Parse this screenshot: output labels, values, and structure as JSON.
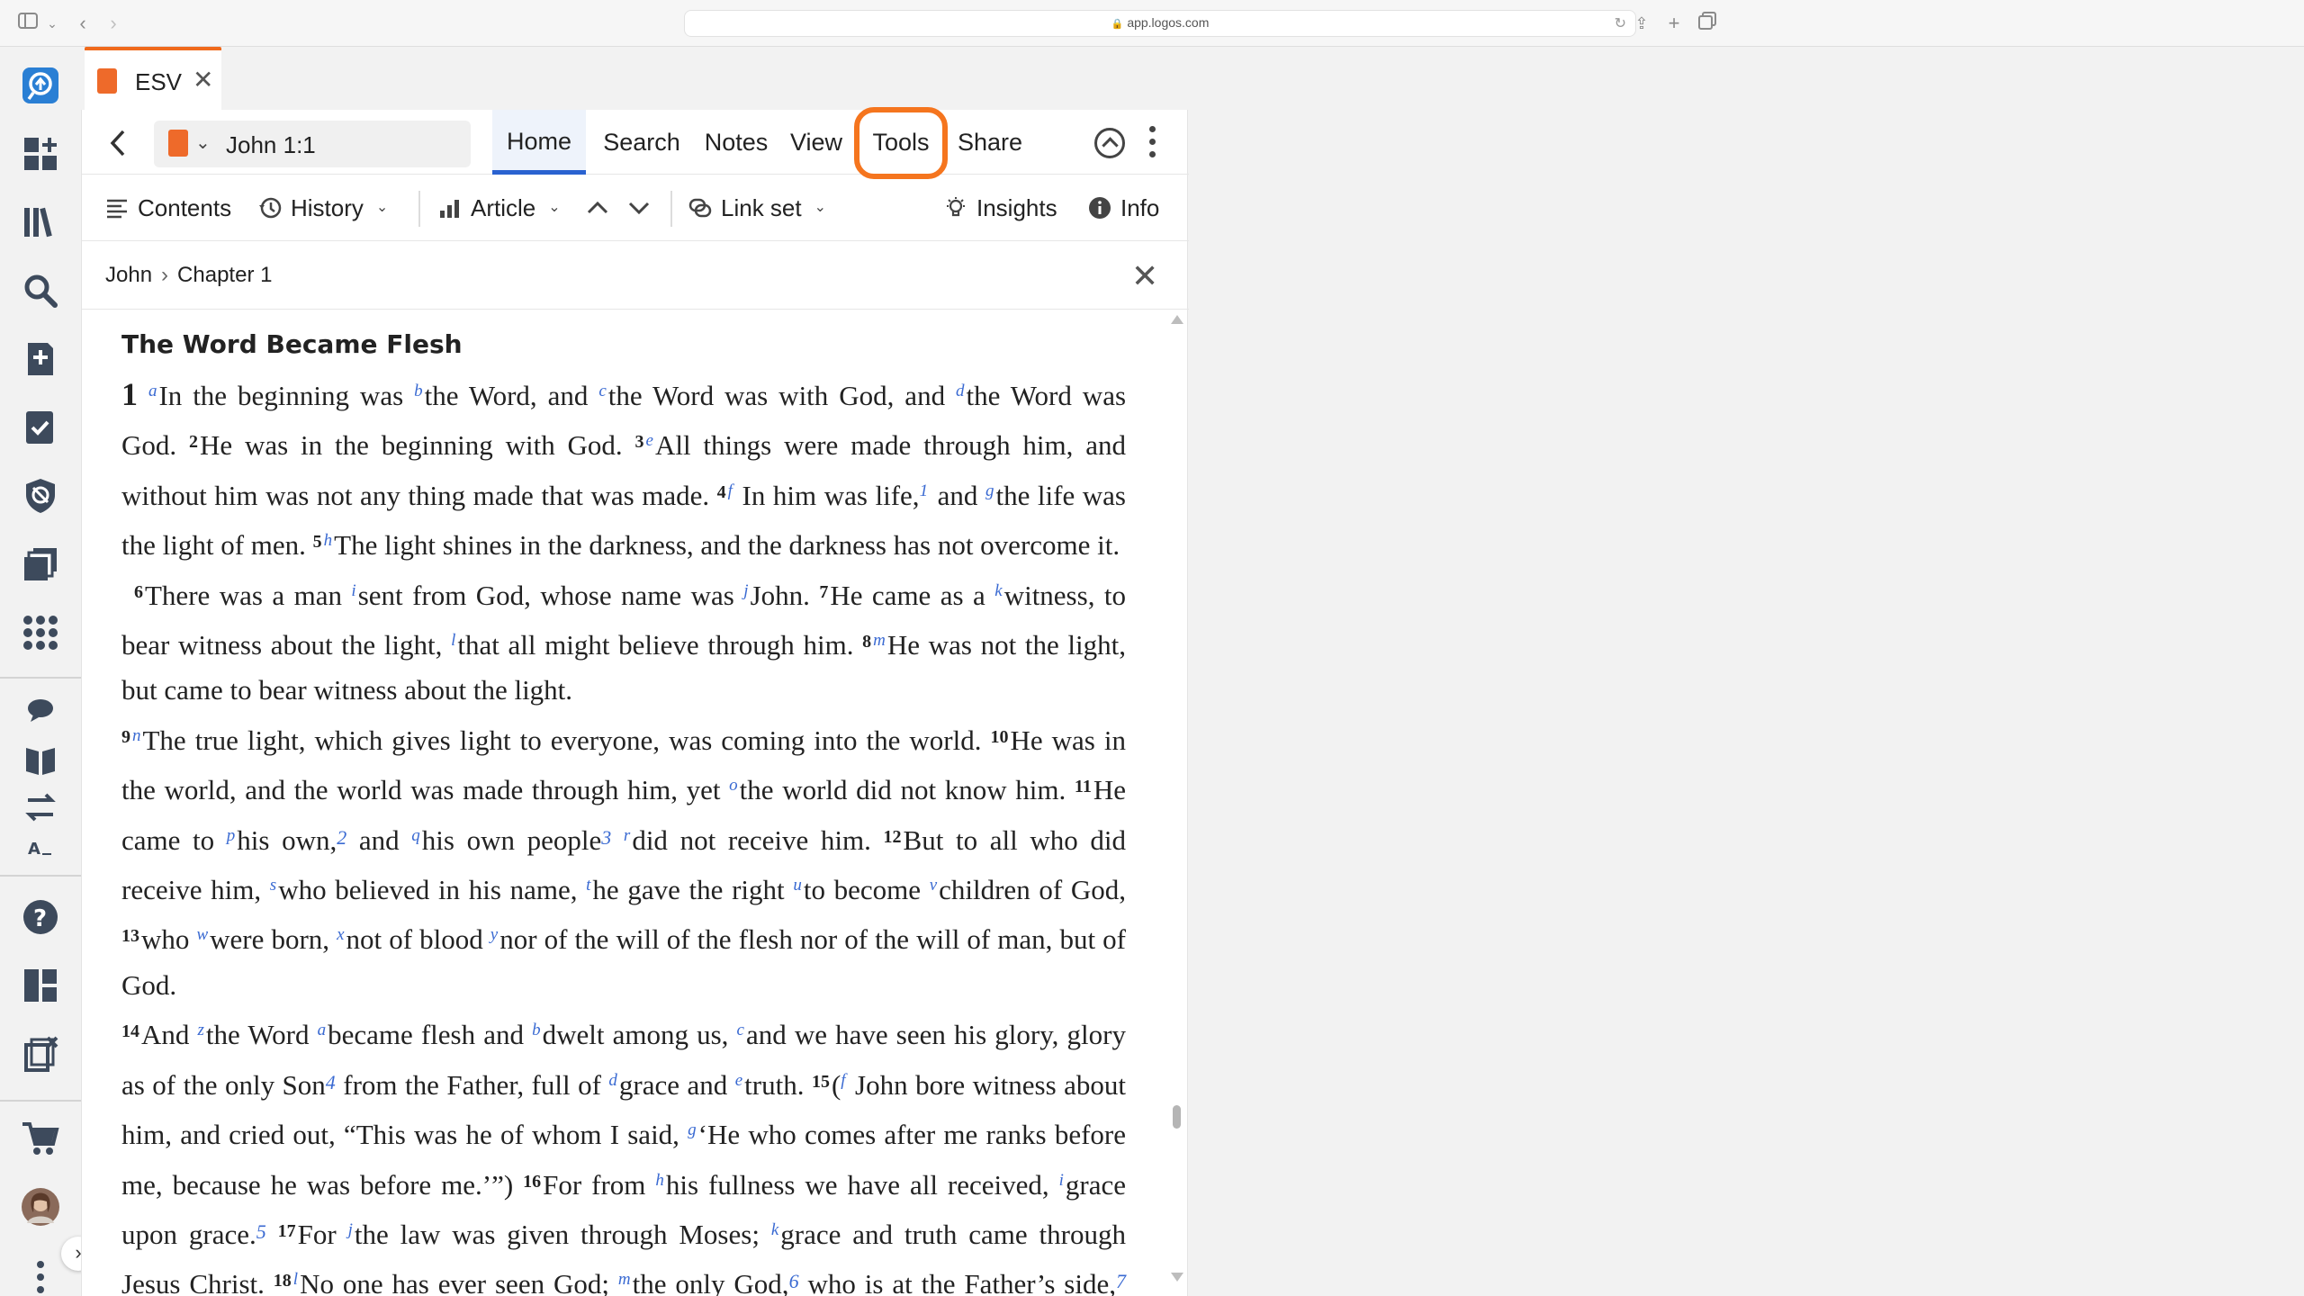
{
  "browser": {
    "url": "app.logos.com"
  },
  "tab": {
    "title": "ESV",
    "close_glyph": "✕"
  },
  "toolbar": {
    "reference": "John 1:1",
    "tabs": [
      "Home",
      "Search",
      "Notes",
      "View",
      "Tools",
      "Share"
    ],
    "active_tab": "Home",
    "highlighted_tab": "Tools"
  },
  "tools_row": {
    "contents": "Contents",
    "history": "History",
    "article": "Article",
    "link_set": "Link set",
    "insights": "Insights",
    "info": "Info"
  },
  "breadcrumb": {
    "book": "John",
    "chapter": "Chapter 1"
  },
  "content": {
    "heading": "The Word Became Flesh"
  },
  "colors": {
    "accent_orange": "#f5751e",
    "active_tab_blue": "#2a62d0",
    "footnote_blue": "#3a6ad2",
    "sidebar_icon": "#3d4a5c"
  },
  "sidebar_icons": [
    "logos-logo-icon",
    "add-dashboard-icon",
    "library-icon",
    "search-icon",
    "add-note-icon",
    "checklist-icon",
    "shield-icon",
    "layouts-icon",
    "apps-grid-icon",
    "chat-icon",
    "open-book-icon",
    "swap-icon",
    "font-size-icon",
    "help-icon",
    "dashboard-icon",
    "close-layouts-icon",
    "cart-icon",
    "avatar",
    "more-vertical-icon"
  ]
}
